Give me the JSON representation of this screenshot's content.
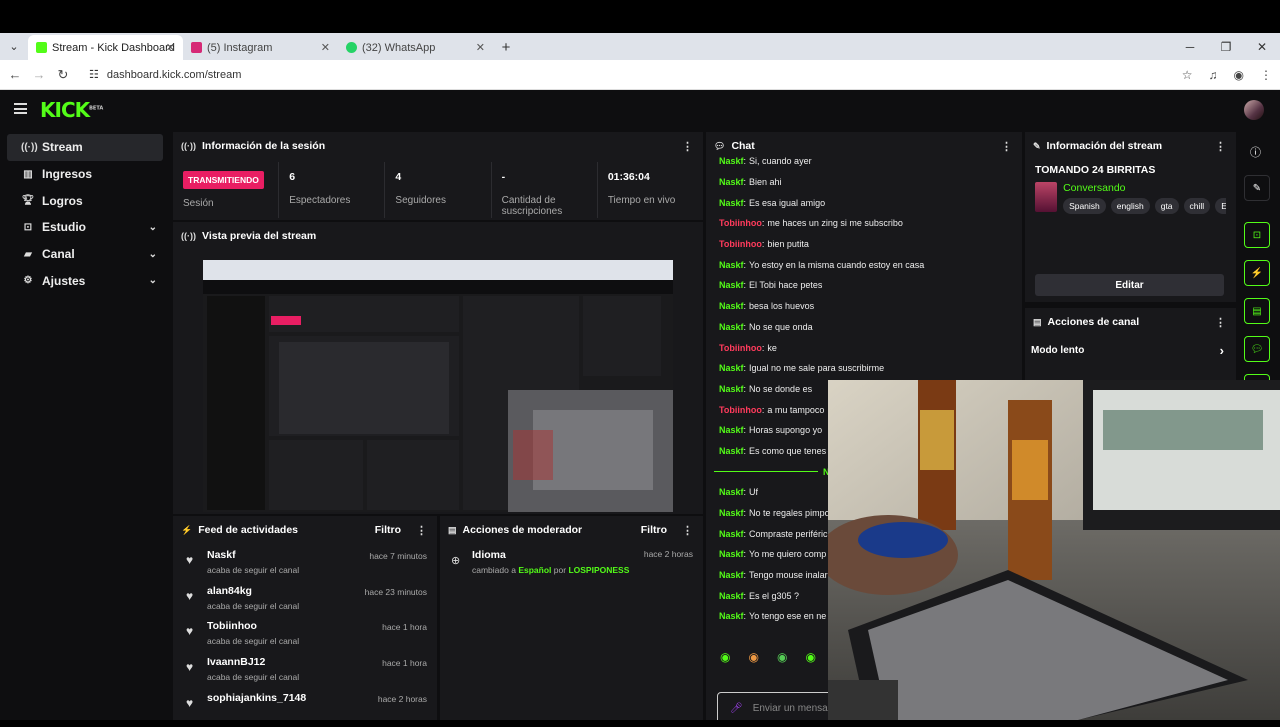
{
  "browser": {
    "tabs": [
      {
        "title": "Stream - Kick Dashboard",
        "active": true,
        "favicon_color": "#53fc18"
      },
      {
        "title": "(5) Instagram",
        "active": false,
        "favicon_color": "#d62976"
      },
      {
        "title": "(32) WhatsApp",
        "active": false,
        "favicon_color": "#25d366"
      }
    ],
    "url": "dashboard.kick.com/stream"
  },
  "header": {
    "logo": "KICK",
    "logo_badge": "BETA"
  },
  "sidebar": {
    "items": [
      {
        "label": "Stream",
        "icon": "broadcast-icon",
        "selected": true,
        "has_chevron": false
      },
      {
        "label": "Ingresos",
        "icon": "chart-icon",
        "selected": false,
        "has_chevron": false
      },
      {
        "label": "Logros",
        "icon": "trophy-icon",
        "selected": false,
        "has_chevron": false
      },
      {
        "label": "Estudio",
        "icon": "studio-icon",
        "selected": false,
        "has_chevron": true
      },
      {
        "label": "Canal",
        "icon": "channel-icon",
        "selected": false,
        "has_chevron": true
      },
      {
        "label": "Ajustes",
        "icon": "gear-icon",
        "selected": false,
        "has_chevron": true
      }
    ]
  },
  "session": {
    "title": "Información de la sesión",
    "status_badge": "TRANSMITIENDO",
    "status_label": "Sesión",
    "stats": [
      {
        "value": "6",
        "label": "Espectadores"
      },
      {
        "value": "4",
        "label": "Seguidores"
      },
      {
        "value": "-",
        "label": "Cantidad de suscripciones"
      },
      {
        "value": "01:36:04",
        "label": "Tiempo en vivo"
      }
    ]
  },
  "preview": {
    "title": "Vista previa del stream"
  },
  "feed": {
    "title": "Feed de actividades",
    "filter": "Filtro",
    "items": [
      {
        "name": "Naskf",
        "action": "acaba de seguir el canal",
        "time": "hace 7 minutos"
      },
      {
        "name": "alan84kg",
        "action": "acaba de seguir el canal",
        "time": "hace 23 minutos"
      },
      {
        "name": "Tobiinhoo",
        "action": "acaba de seguir el canal",
        "time": "hace 1 hora"
      },
      {
        "name": "IvaannBJ12",
        "action": "acaba de seguir el canal",
        "time": "hace 1 hora"
      },
      {
        "name": "sophiajankins_7148",
        "action": "",
        "time": "hace 2 horas"
      }
    ]
  },
  "mod": {
    "title": "Acciones de moderador",
    "filter": "Filtro",
    "items": [
      {
        "title": "Idioma",
        "text_pre": "cambiado a",
        "value": "Español",
        "text_by": "por",
        "user": "LOSPIPONESS",
        "time": "hace 2 horas"
      }
    ]
  },
  "chat": {
    "title": "Chat",
    "placeholder": "Enviar un mensa",
    "messages": [
      {
        "user": "Naskf",
        "text": "Si, cuando ayer",
        "color": "#53fc18"
      },
      {
        "user": "Naskf",
        "text": "Bien ahi",
        "color": "#53fc18"
      },
      {
        "user": "Naskf",
        "text": "Es esa igual amigo",
        "color": "#53fc18"
      },
      {
        "user": "Tobiinhoo",
        "text": "me haces un zing si me subscribo",
        "color": "#ff3b5c"
      },
      {
        "user": "Tobiinhoo",
        "text": "bien putita",
        "color": "#ff3b5c"
      },
      {
        "user": "Naskf",
        "text": "Yo estoy en la misma cuando estoy en casa",
        "color": "#53fc18"
      },
      {
        "user": "Naskf",
        "text": "El Tobi hace petes",
        "color": "#53fc18"
      },
      {
        "user": "Naskf",
        "text": "besa los huevos",
        "color": "#53fc18"
      },
      {
        "user": "Naskf",
        "text": "No se que onda",
        "color": "#53fc18"
      },
      {
        "user": "Tobiinhoo",
        "text": "ke",
        "color": "#ff3b5c"
      },
      {
        "user": "Naskf",
        "text": "Igual no me sale para suscribirme",
        "color": "#53fc18"
      },
      {
        "user": "Naskf",
        "text": "No se donde es",
        "color": "#53fc18"
      },
      {
        "user": "Tobiinhoo",
        "text": "a mu tampoco",
        "color": "#ff3b5c"
      },
      {
        "user": "Naskf",
        "text": "Horas supongo yo",
        "color": "#53fc18"
      },
      {
        "user": "Naskf",
        "text": "Es como que tenes",
        "color": "#53fc18"
      },
      {
        "user": "Naskf",
        "text": "Uf",
        "color": "#53fc18"
      },
      {
        "user": "Naskf",
        "text": "No te regales pimpo",
        "color": "#53fc18"
      },
      {
        "user": "Naskf",
        "text": "Compraste periféric",
        "color": "#53fc18"
      },
      {
        "user": "Naskf",
        "text": "Yo me quiero comp",
        "color": "#53fc18"
      },
      {
        "user": "Naskf",
        "text": "Tengo mouse inalar",
        "color": "#53fc18"
      },
      {
        "user": "Naskf",
        "text": "Es el g305 ?",
        "color": "#53fc18"
      },
      {
        "user": "Naskf",
        "text": "Yo tengo ese en ne",
        "color": "#53fc18"
      }
    ],
    "divider_letter": "N"
  },
  "stream_info": {
    "title": "Información del stream",
    "stream_title": "TOMANDO 24 BIRRITAS",
    "category": "Conversando",
    "tags": [
      "Spanish",
      "english",
      "gta",
      "chill",
      "E"
    ],
    "edit_button": "Editar"
  },
  "channel_actions": {
    "title": "Acciones de canal",
    "slow_mode": "Modo lento"
  },
  "colors": {
    "accent": "#53fc18",
    "live": "#e91e63",
    "panel": "#18181b",
    "bg": "#0e0e10"
  }
}
